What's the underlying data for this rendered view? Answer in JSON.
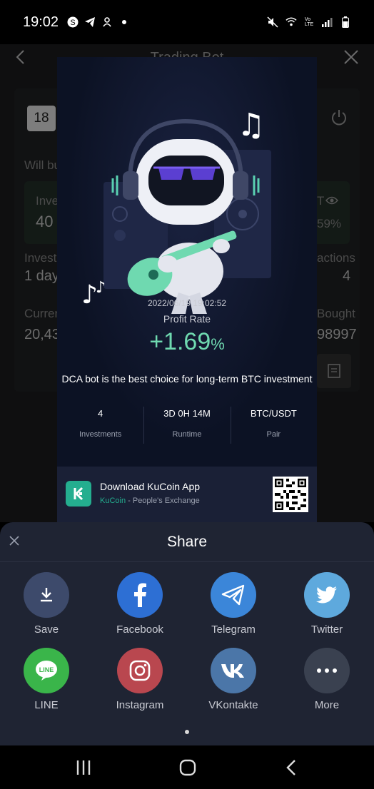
{
  "status_bar": {
    "time": "19:02",
    "left_icons": [
      "s-coin-icon",
      "telegram-icon",
      "notification-icon",
      "dot-icon"
    ],
    "right_icons": [
      "mute-icon",
      "wifi-icon",
      "volte-icon",
      "signal-icon",
      "battery-icon"
    ],
    "volte_label": "Vo\nLTE"
  },
  "background_page": {
    "title": "Trading Bot",
    "date_icon_label": "18",
    "will_text": "Will bu",
    "invest_label": "Inve",
    "invest_value": "40",
    "t_label": "T",
    "percent_value": "59%",
    "investment_label": "Invest",
    "duration_value": "1 day",
    "actions_label": "actions",
    "actions_value": "4",
    "current_label": "Curren",
    "current_value": "20,43",
    "bought_label": "Bought",
    "bought_value": "98997"
  },
  "card": {
    "timestamp": "2022/06/19 19:02:52",
    "profit_label": "Profit Rate",
    "profit_number": "+1.69",
    "profit_unit": "%",
    "tagline": "DCA bot is the best choice for long-term BTC investment",
    "stats": [
      {
        "value": "4",
        "label": "Investments"
      },
      {
        "value": "3D 0H 14M",
        "label": "Runtime"
      },
      {
        "value": "BTC/USDT",
        "label": "Pair"
      }
    ],
    "footer": {
      "title": "Download KuCoin App",
      "brand": "KuCoin",
      "slogan": " - People's Exchange"
    }
  },
  "share_sheet": {
    "title": "Share",
    "items": [
      {
        "label": "Save",
        "icon": "download-icon",
        "color": "#3d4a6b"
      },
      {
        "label": "Facebook",
        "icon": "facebook-icon",
        "color": "#2d6fd4"
      },
      {
        "label": "Telegram",
        "icon": "telegram-icon",
        "color": "#3b86d9"
      },
      {
        "label": "Twitter",
        "icon": "twitter-icon",
        "color": "#5ea9dd"
      },
      {
        "label": "LINE",
        "icon": "line-icon",
        "color": "#3ab54a"
      },
      {
        "label": "Instagram",
        "icon": "instagram-icon",
        "color": "#b9474f"
      },
      {
        "label": "VKontakte",
        "icon": "vk-icon",
        "color": "#4b76a8"
      },
      {
        "label": "More",
        "icon": "more-icon",
        "color": "#3a4150"
      }
    ]
  },
  "colors": {
    "accent_green": "#6fd9b0",
    "kucoin_green": "#24ae8f",
    "sheet_bg": "#1f2433"
  }
}
